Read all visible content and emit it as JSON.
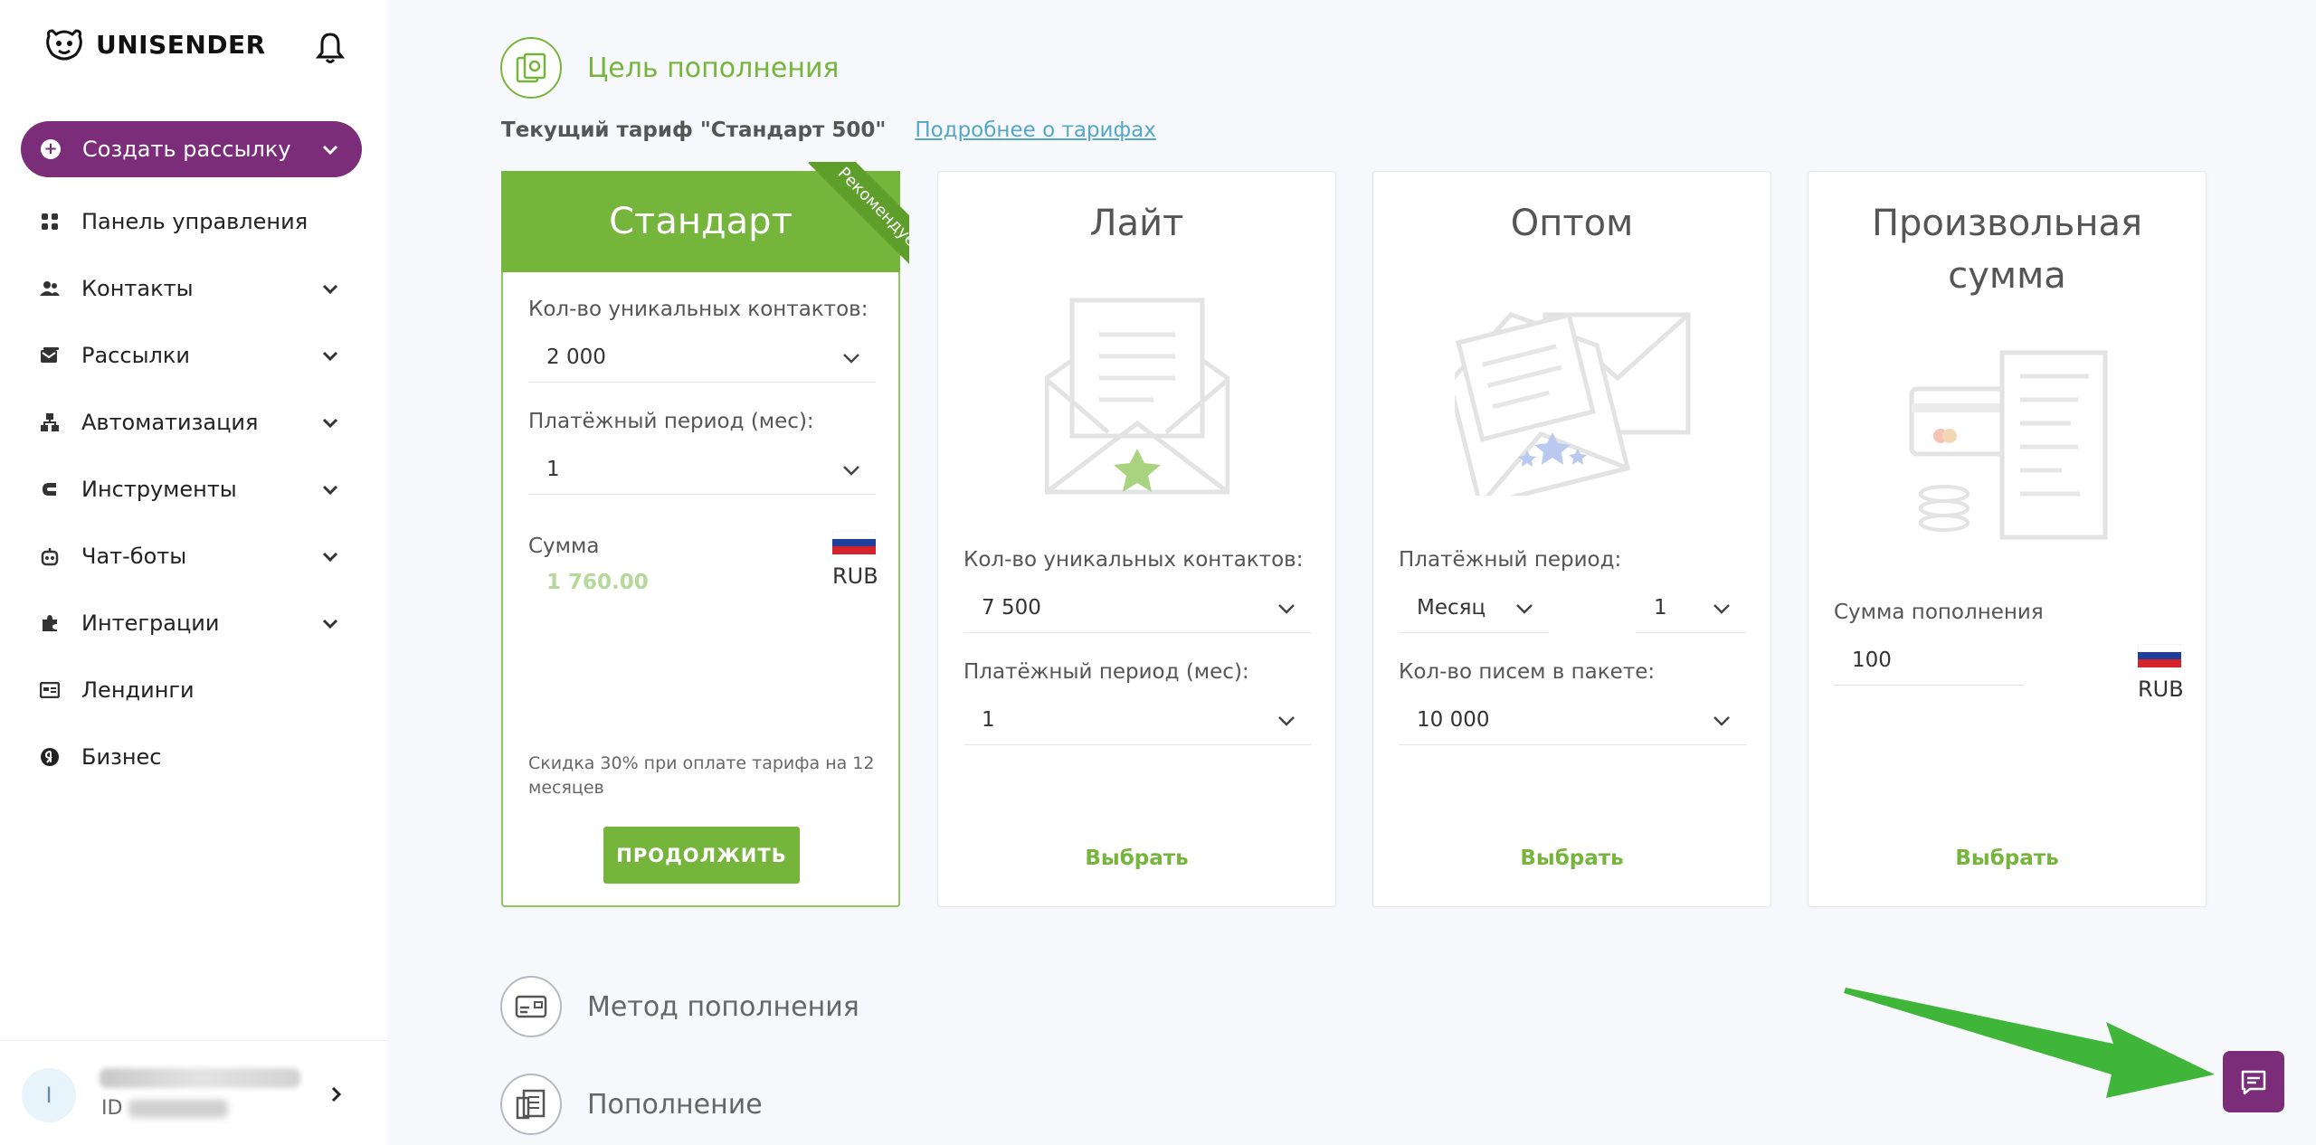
{
  "brand": {
    "name": "UNISENDER"
  },
  "sidebar": {
    "create_button": "Создать рассылку",
    "items": [
      {
        "label": "Панель управления",
        "icon": "grid-icon",
        "has_chevron": false
      },
      {
        "label": "Контакты",
        "icon": "users-icon",
        "has_chevron": true
      },
      {
        "label": "Рассылки",
        "icon": "mail-stack-icon",
        "has_chevron": true
      },
      {
        "label": "Автоматизация",
        "icon": "hierarchy-icon",
        "has_chevron": true
      },
      {
        "label": "Инструменты",
        "icon": "magnet-icon",
        "has_chevron": true
      },
      {
        "label": "Чат-боты",
        "icon": "robot-icon",
        "has_chevron": true
      },
      {
        "label": "Интеграции",
        "icon": "puzzle-icon",
        "has_chevron": true
      },
      {
        "label": "Лендинги",
        "icon": "landing-icon",
        "has_chevron": false
      },
      {
        "label": "Бизнес",
        "icon": "yandex-icon",
        "has_chevron": false
      }
    ],
    "user": {
      "avatar_letter": "I",
      "id_prefix": "ID"
    }
  },
  "sections": {
    "goal": "Цель пополнения",
    "method": "Метод пополнения",
    "replenish": "Пополнение"
  },
  "tariff": {
    "current": "Текущий тариф \"Стандарт 500\"",
    "more_link": "Подробнее о тарифах"
  },
  "cards": {
    "standard": {
      "title": "Стандарт",
      "ribbon": "Рекомендуем",
      "contacts_label": "Кол-во уникальных контактов:",
      "contacts_value": "2 000",
      "period_label": "Платёжный период (мес):",
      "period_value": "1",
      "sum_label": "Сумма",
      "sum_value": "1 760.00",
      "currency": "RUB",
      "discount": "Скидка 30% при оплате тарифа на 12 месяцев",
      "continue": "ПРОДОЛЖИТЬ"
    },
    "lite": {
      "title": "Лайт",
      "contacts_label": "Кол-во уникальных контактов:",
      "contacts_value": "7 500",
      "period_label": "Платёжный период (мес):",
      "period_value": "1",
      "pick": "Выбрать"
    },
    "bulk": {
      "title": "Оптом",
      "period_label": "Платёжный период:",
      "period_unit": "Месяц",
      "period_value": "1",
      "letters_label": "Кол-во писем в пакете:",
      "letters_value": "10 000",
      "pick": "Выбрать"
    },
    "custom": {
      "title_line1": "Произвольная",
      "title_line2": "сумма",
      "sum_label": "Сумма пополнения",
      "sum_value": "100",
      "currency": "RUB",
      "pick": "Выбрать"
    }
  },
  "colors": {
    "brand_purple": "#7b2d7a",
    "green": "#76b53c",
    "link": "#54a6c9",
    "arrow_green": "#3fb53a"
  }
}
